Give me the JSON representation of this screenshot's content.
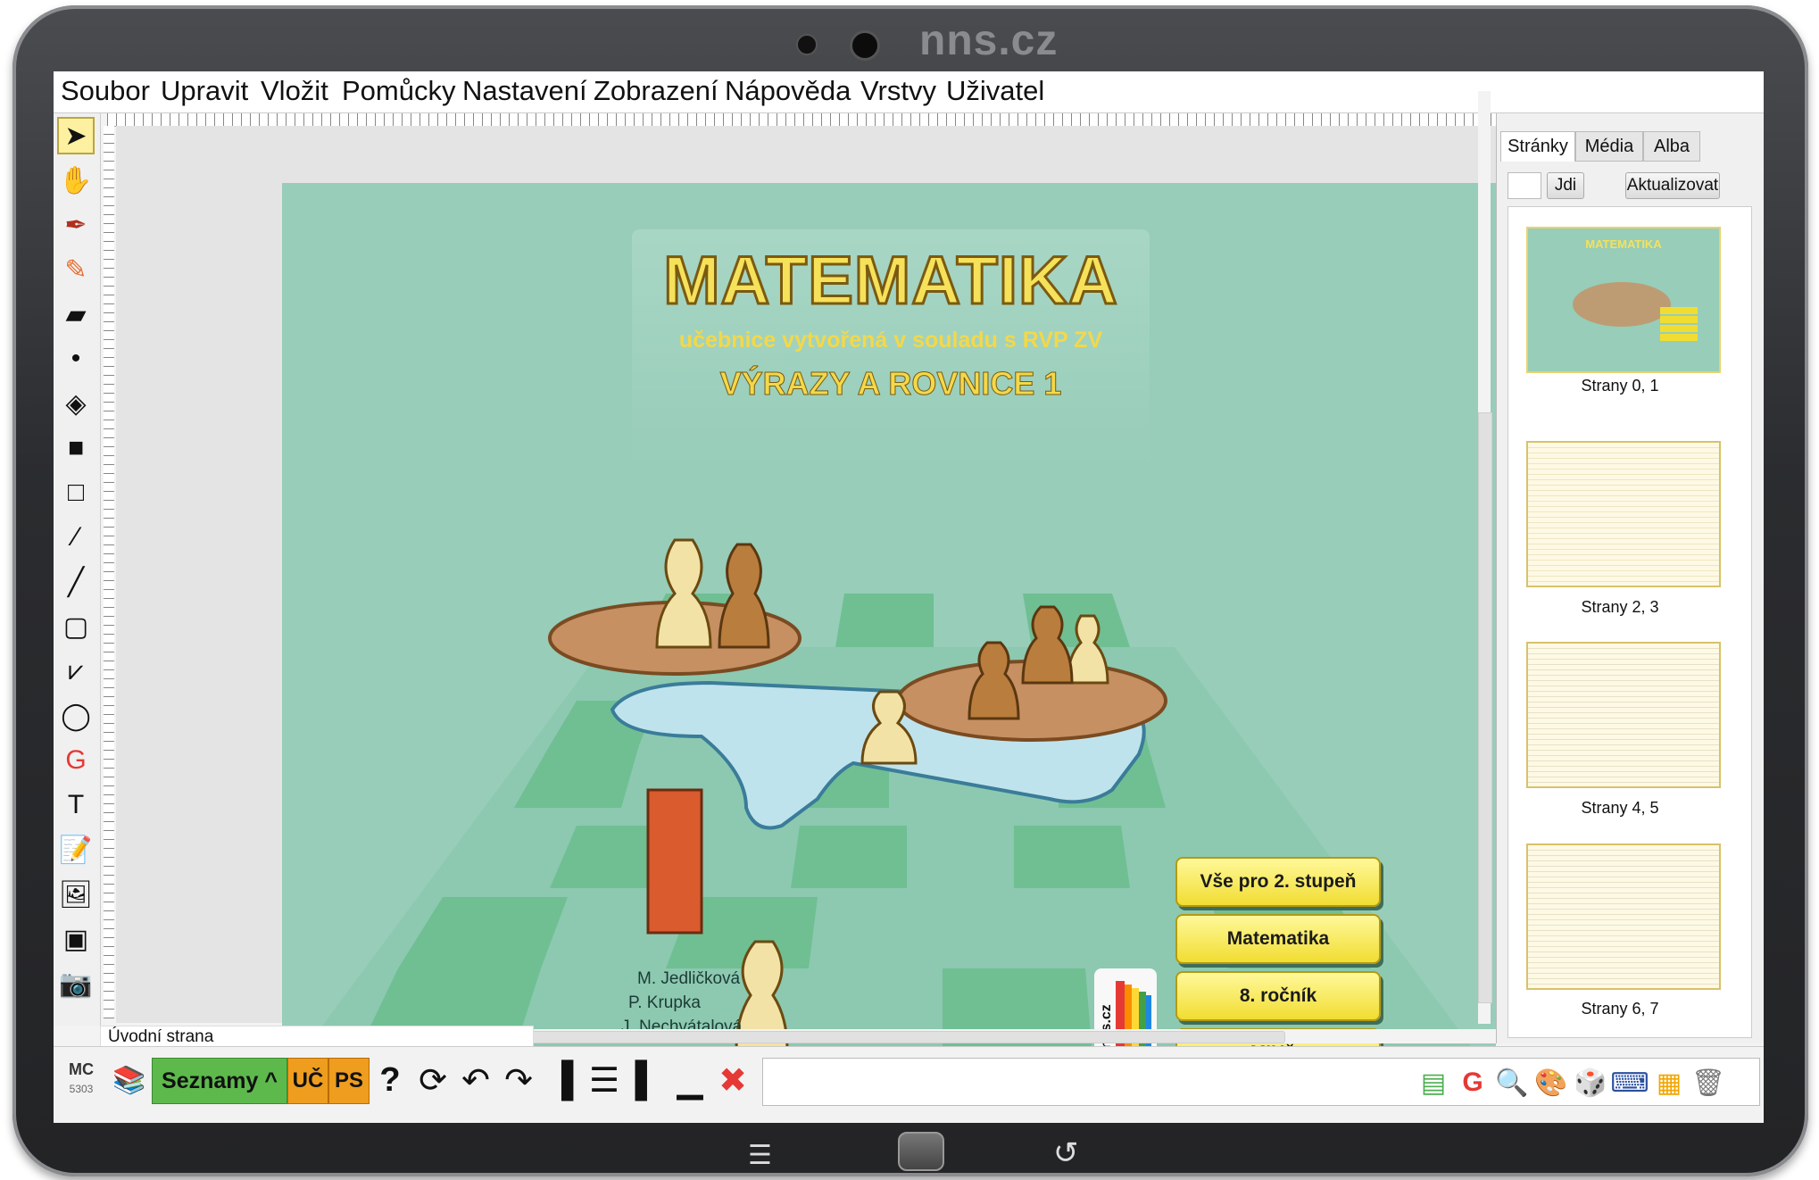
{
  "device": {
    "brand": "nns.cz"
  },
  "menu": [
    "Soubor",
    "Upravit",
    "Vložit",
    "Pomůcky",
    "Nastavení",
    "Zobrazení",
    "Nápověda",
    "Vrstvy",
    "Uživatel"
  ],
  "tools": [
    {
      "name": "select-arrow-icon",
      "glyph": "➤"
    },
    {
      "name": "hand-icon",
      "glyph": "✋"
    },
    {
      "name": "pen-icon",
      "glyph": "✒"
    },
    {
      "name": "highlighter-icon",
      "glyph": "✎"
    },
    {
      "name": "eraser-icon",
      "glyph": "▰"
    },
    {
      "name": "dot-icon",
      "glyph": "•"
    },
    {
      "name": "fill-bucket-icon",
      "glyph": "◈"
    },
    {
      "name": "fill-color-icon",
      "glyph": "■"
    },
    {
      "name": "line-color-icon",
      "glyph": "□"
    },
    {
      "name": "eyedropper-icon",
      "glyph": "⁄"
    },
    {
      "name": "line-icon",
      "glyph": "╱"
    },
    {
      "name": "rectangle-icon",
      "glyph": "▢"
    },
    {
      "name": "polygon-icon",
      "glyph": "⩗"
    },
    {
      "name": "ellipse-icon",
      "glyph": "◯"
    },
    {
      "name": "geogebra-icon",
      "glyph": "G"
    },
    {
      "name": "text-icon",
      "glyph": "T"
    },
    {
      "name": "new-note-icon",
      "glyph": "📝"
    },
    {
      "name": "insert-image-icon",
      "glyph": "🖼"
    },
    {
      "name": "insert-media-icon",
      "glyph": "▣"
    },
    {
      "name": "camera-icon",
      "glyph": "📷"
    }
  ],
  "page": {
    "title": "MATEMATIKA",
    "subtitle": "učebnice vytvořená v souladu s RVP ZV",
    "topic": "VÝRAZY A ROVNICE 1",
    "authors": [
      "M. Jedličková",
      "P. Krupka",
      "J. Nechvátalová"
    ],
    "buttons": [
      "Vše pro 2. stupeň",
      "Matematika",
      "8. ročník",
      "MIUč+"
    ],
    "logo_text": "nns.cz",
    "label": "Úvodní strana"
  },
  "right_panel": {
    "tabs": [
      "Stránky",
      "Média",
      "Alba"
    ],
    "active_tab": "Stránky",
    "go_button": "Jdi",
    "refresh_button": "Aktualizovat",
    "thumbnails": [
      {
        "label": "Strany 0, 1",
        "thumb_title": "MATEMATIKA"
      },
      {
        "label": "Strany 2, 3"
      },
      {
        "label": "Strany 4, 5"
      },
      {
        "label": "Strany 6, 7"
      }
    ]
  },
  "bottom_bar": {
    "mc": "MC",
    "mc_number": "5303",
    "lists_button": "Seznamy ^",
    "uc_button": "UČ",
    "ps_button": "PS",
    "help": "?",
    "status_text": ""
  },
  "colors": {
    "page_bg": "#97cdb9",
    "title_yellow": "#f6e15a",
    "button_yellow": "#f1dd32",
    "lists_green": "#5db94c",
    "orange": "#ef9d1e",
    "tablet_frame": "#2b2c2f"
  }
}
